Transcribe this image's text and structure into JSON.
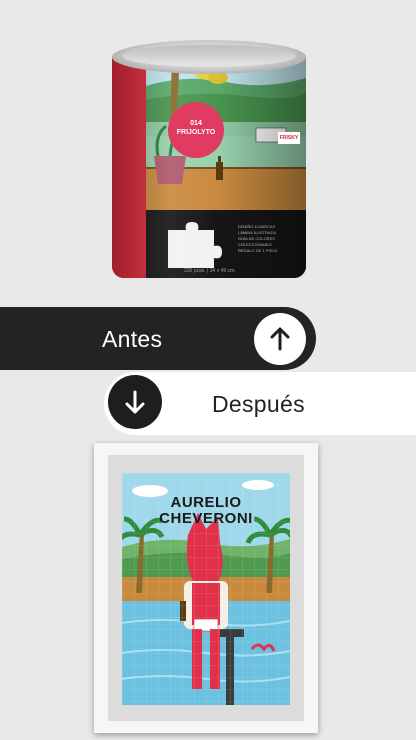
{
  "before_product": {
    "sticker_line1": "014",
    "sticker_line2": "FRIJOLYTO",
    "sign_text": "FRISKY",
    "caption": "330 pzas. | 34 x 49 cm.",
    "features": [
      "DISEÑO & MARCAS",
      "LÁMINA ILUSTRADA",
      "GUÍA DE COLORES",
      "COLECCIONABLE",
      "REGALO DE 1 PIEZA"
    ]
  },
  "antes": {
    "label": "Antes",
    "icon": "arrow-up-icon"
  },
  "despues": {
    "label": "Después",
    "icon": "arrow-down-icon"
  },
  "after_product": {
    "title_line1": "AURELIO",
    "title_line2": "CHEVERONI"
  },
  "colors": {
    "dark": "#232323",
    "white": "#ffffff",
    "background": "#e9e9e9",
    "can_red": "#d8293a",
    "sticker_pink": "#e23b62",
    "pool_blue": "#7ec8e3",
    "character_red": "#e0304a"
  }
}
